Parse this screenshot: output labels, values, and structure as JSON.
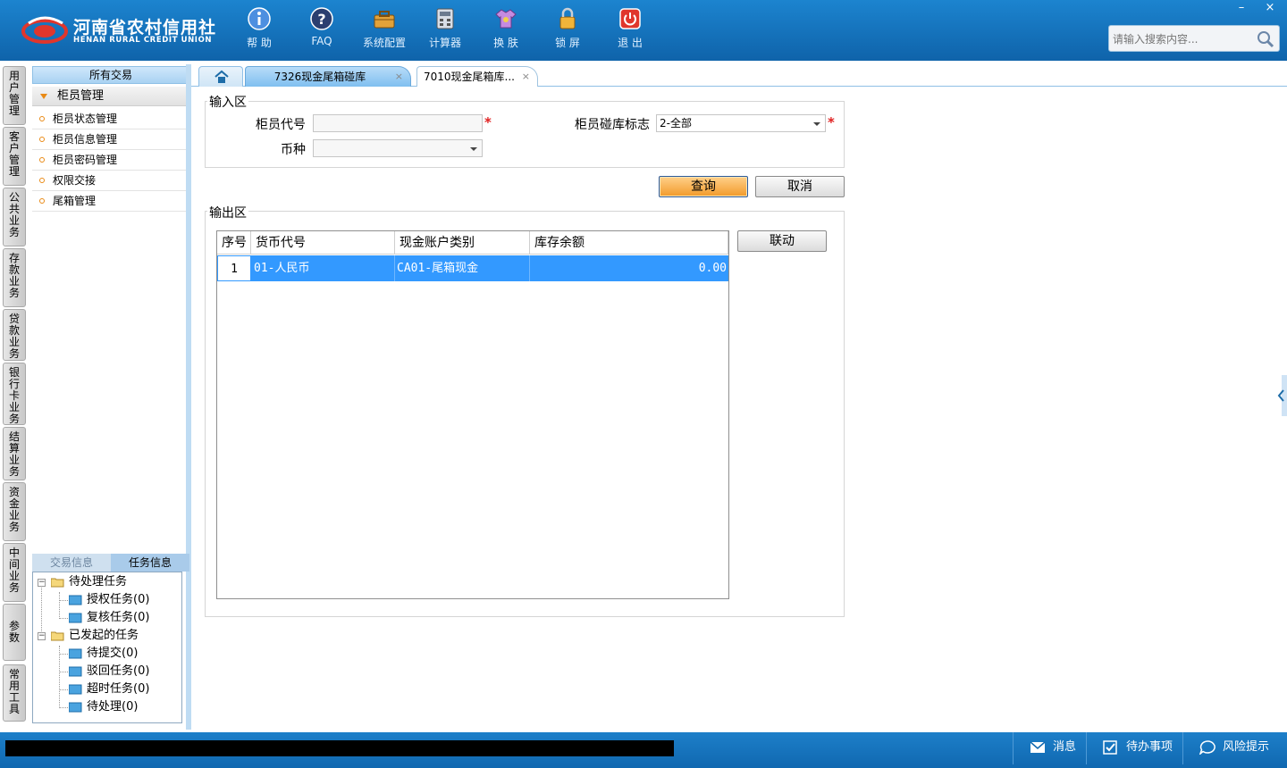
{
  "app": {
    "logo_cn": "河南省农村信用社",
    "logo_en": "HENAN RURAL CREDIT UNION"
  },
  "toolbar": [
    {
      "label": "帮 助",
      "icon": "info-icon"
    },
    {
      "label": "FAQ",
      "icon": "question-icon"
    },
    {
      "label": "系统配置",
      "icon": "toolbox-icon"
    },
    {
      "label": "计算器",
      "icon": "calculator-icon"
    },
    {
      "label": "换 肤",
      "icon": "shirt-icon"
    },
    {
      "label": "锁 屏",
      "icon": "lock-icon"
    },
    {
      "label": "退 出",
      "icon": "power-icon"
    }
  ],
  "search": {
    "placeholder": "请输入搜索内容..."
  },
  "window": {
    "minimize": "–",
    "close": "×"
  },
  "vtabs": [
    "用户管理",
    "客户管理",
    "公共业务",
    "存款业务",
    "贷款业务",
    "银行卡业务",
    "结算业务",
    "资金业务",
    "中间业务",
    "参数",
    "常用工具"
  ],
  "left_panel": {
    "header": "所有交易",
    "group": "柜员管理",
    "items": [
      "柜员状态管理",
      "柜员信息管理",
      "柜员密码管理",
      "权限交接",
      "尾箱管理"
    ],
    "task_tabs": [
      "交易信息",
      "任务信息"
    ],
    "tree": {
      "pending": "待处理任务",
      "pending_children": [
        "授权任务(0)",
        "复核任务(0)"
      ],
      "initiated": "已发起的任务",
      "initiated_children": [
        "待提交(0)",
        "驳回任务(0)",
        "超时任务(0)",
        "待处理(0)"
      ]
    }
  },
  "tabs": {
    "home_icon": "home-icon",
    "tab1": "7326现金尾箱碰库",
    "tab2": "7010现金尾箱库...",
    "close": "×"
  },
  "form": {
    "input_legend": "输入区",
    "teller_code_label": "柜员代号",
    "teller_code_value": "",
    "currency_label": "币种",
    "currency_value": "",
    "flag_label": "柜员碰库标志",
    "flag_value": "2-全部",
    "required_mark": "*",
    "query_button": "查询",
    "cancel_button": "取消",
    "output_legend": "输出区",
    "link_button": "联动"
  },
  "grid": {
    "columns": [
      "序号",
      "货币代号",
      "现金账户类别",
      "库存余额"
    ],
    "rows": [
      [
        "1",
        "01-人民币",
        "CA01-尾箱现金",
        "0.00"
      ]
    ]
  },
  "statusbar": {
    "message": "消息",
    "todo": "待办事项",
    "risk": "风险提示"
  },
  "colors": {
    "top_bar": "#1572bd",
    "selected_row": "#3399ff",
    "query_button": "#f29a2a",
    "accent_orange": "#e98a15"
  }
}
